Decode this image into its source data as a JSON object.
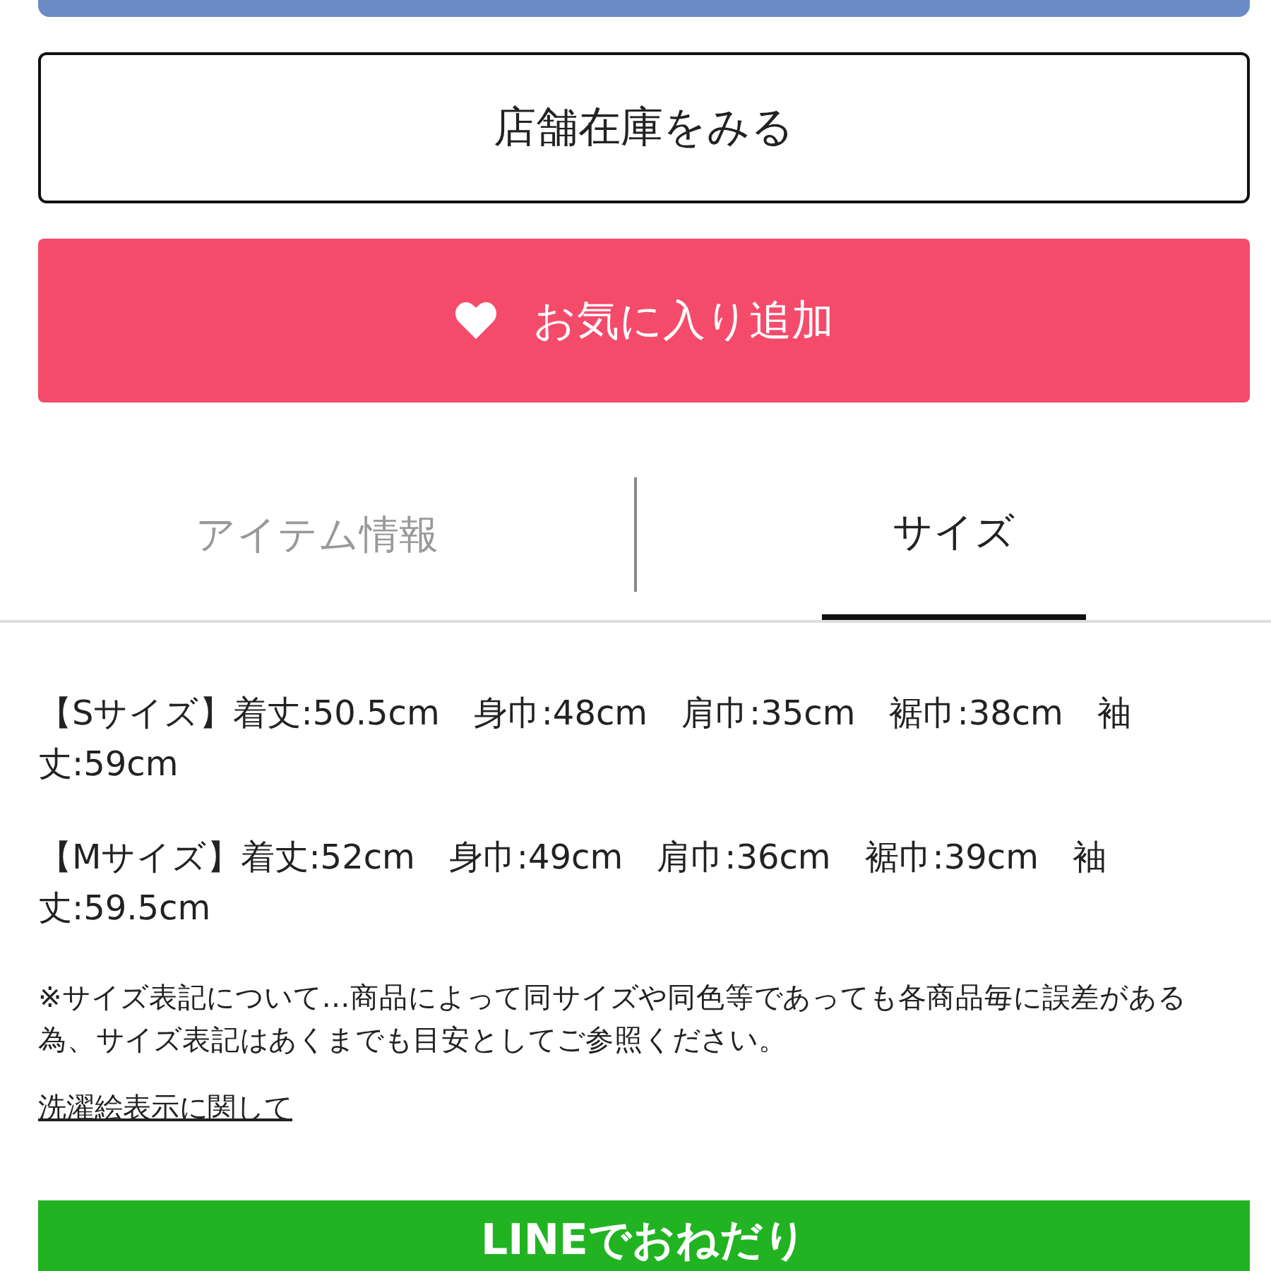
{
  "store_stock_button": {
    "label": "店舗在庫をみる"
  },
  "favorite_button": {
    "label": "お気に入り追加"
  },
  "tabs": [
    {
      "label": "アイテム情報",
      "selected": false
    },
    {
      "label": "サイズ",
      "selected": true
    }
  ],
  "size_info": [
    "【Sサイズ】着丈:50.5cm　身巾:48cm　肩巾:35cm　裾巾:38cm　袖丈:59cm",
    "【Mサイズ】着丈:52cm　身巾:49cm　肩巾:36cm　裾巾:39cm　袖丈:59.5cm"
  ],
  "note": "※サイズ表記について…商品によって同サイズや同色等であっても各商品毎に誤差がある為、サイズ表記はあくまでも目安としてご参照ください。",
  "laundry_link": "洗濯絵表示に関して",
  "line_button": {
    "label": "LINEでおねだり"
  }
}
